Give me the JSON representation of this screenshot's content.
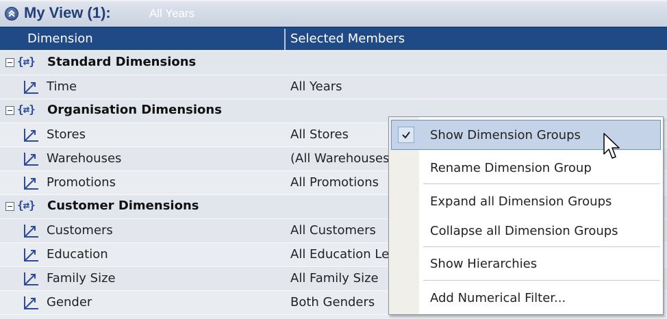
{
  "view": {
    "title": "My View (1):",
    "subtitle": "All Years"
  },
  "columns": {
    "dimension": "Dimension",
    "selected_members": "Selected Members"
  },
  "groups": {
    "standard": "Standard Dimensions",
    "organisation": "Organisation Dimensions",
    "customer": "Customer Dimensions"
  },
  "dimensions": [
    {
      "name": "Time",
      "member": "All Years"
    },
    {
      "name": "Stores",
      "member": "All Stores"
    },
    {
      "name": "Warehouses",
      "member": "(All Warehouses)"
    },
    {
      "name": "Promotions",
      "member": "All Promotions"
    },
    {
      "name": "Customers",
      "member": "All Customers"
    },
    {
      "name": "Education",
      "member": "All Education Levels"
    },
    {
      "name": "Family Size",
      "member": "All Family Size"
    },
    {
      "name": "Gender",
      "member": "Both Genders"
    }
  ],
  "context_menu": {
    "items": [
      {
        "label": "Show Dimension Groups",
        "checked": true
      },
      {
        "label": "Rename Dimension Group"
      },
      {
        "label": "Expand all Dimension Groups"
      },
      {
        "label": "Collapse all Dimension Groups"
      },
      {
        "label": "Show Hierarchies"
      },
      {
        "label": "Add Numerical Filter..."
      }
    ]
  },
  "icons": {
    "collapse_view": "double-chevron-up-icon",
    "group": "dimension-group-icon",
    "dimension": "dimension-icon",
    "expander": "minus-box-icon",
    "check": "checkmark-icon",
    "cursor": "mouse-pointer-icon"
  },
  "colors": {
    "header": "#1f4a86",
    "title": "#223f7a",
    "menu_highlight": "#c5d3e9"
  }
}
